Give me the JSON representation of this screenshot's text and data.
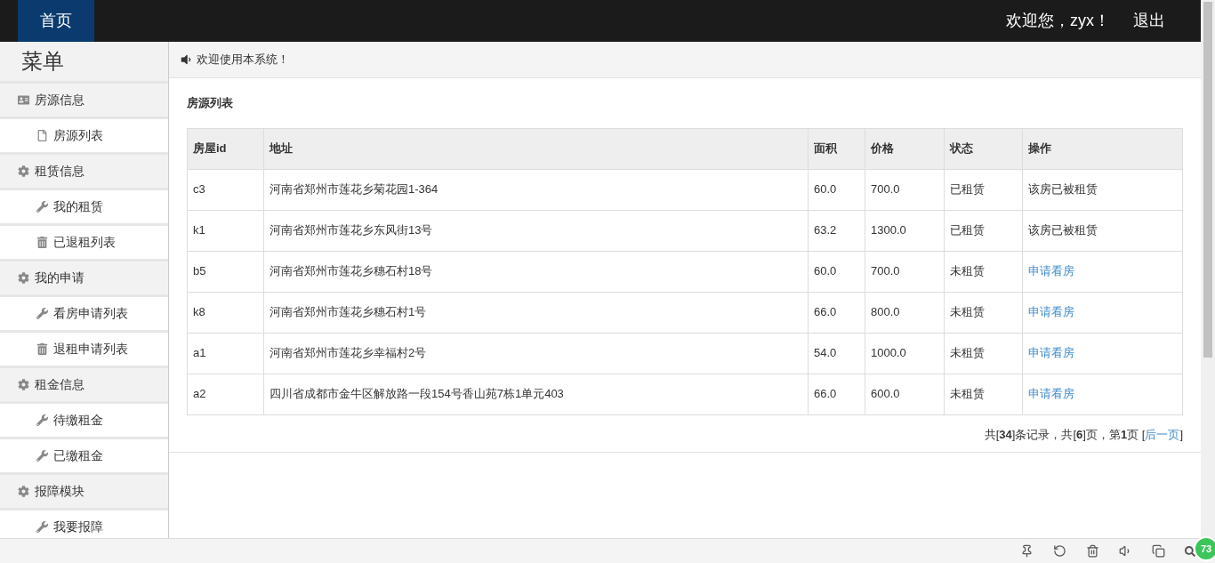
{
  "topbar": {
    "home": "首页",
    "welcome": "欢迎您，zyx！",
    "logout": "退出"
  },
  "sidebar": {
    "title": "菜单",
    "items": [
      {
        "kind": "card",
        "label": "房源信息"
      },
      {
        "kind": "file",
        "label": "房源列表"
      },
      {
        "kind": "gear",
        "label": "租赁信息"
      },
      {
        "kind": "wrench",
        "label": "我的租赁"
      },
      {
        "kind": "trash",
        "label": "已退租列表"
      },
      {
        "kind": "gear",
        "label": "我的申请"
      },
      {
        "kind": "wrench",
        "label": "看房申请列表"
      },
      {
        "kind": "trash",
        "label": "退租申请列表"
      },
      {
        "kind": "gear",
        "label": "租金信息"
      },
      {
        "kind": "wrench",
        "label": "待缴租金"
      },
      {
        "kind": "wrench",
        "label": "已缴租金"
      },
      {
        "kind": "gear",
        "label": "报障模块"
      },
      {
        "kind": "wrench",
        "label": "我要报障"
      }
    ]
  },
  "notice": "欢迎使用本系统！",
  "table": {
    "title": "房源列表",
    "columns": [
      "房屋id",
      "地址",
      "面积",
      "价格",
      "状态",
      "操作"
    ],
    "rows": [
      {
        "cells": [
          "c3",
          "河南省郑州市莲花乡菊花园1-364",
          "60.0",
          "700.0",
          "已租赁"
        ],
        "action": {
          "kind": "text",
          "label": "该房已被租赁"
        }
      },
      {
        "cells": [
          "k1",
          "河南省郑州市莲花乡东风街13号",
          "63.2",
          "1300.0",
          "已租赁"
        ],
        "action": {
          "kind": "text",
          "label": "该房已被租赁"
        }
      },
      {
        "cells": [
          "b5",
          "河南省郑州市莲花乡穗石村18号",
          "60.0",
          "700.0",
          "未租赁"
        ],
        "action": {
          "kind": "link",
          "label": "申请看房"
        }
      },
      {
        "cells": [
          "k8",
          "河南省郑州市莲花乡穗石村1号",
          "66.0",
          "800.0",
          "未租赁"
        ],
        "action": {
          "kind": "link",
          "label": "申请看房"
        }
      },
      {
        "cells": [
          "a1",
          "河南省郑州市莲花乡幸福村2号",
          "54.0",
          "1000.0",
          "未租赁"
        ],
        "action": {
          "kind": "link",
          "label": "申请看房"
        }
      },
      {
        "cells": [
          "a2",
          "四川省成都市金牛区解放路一段154号香山苑7栋1单元403",
          "66.0",
          "600.0",
          "未租赁"
        ],
        "action": {
          "kind": "link",
          "label": "申请看房"
        }
      }
    ]
  },
  "pagination": {
    "summary": "共[**34**]条记录，共[**6**]页，第**1**页 [",
    "next": "后一页",
    "suffix": "]"
  },
  "badge": "73"
}
